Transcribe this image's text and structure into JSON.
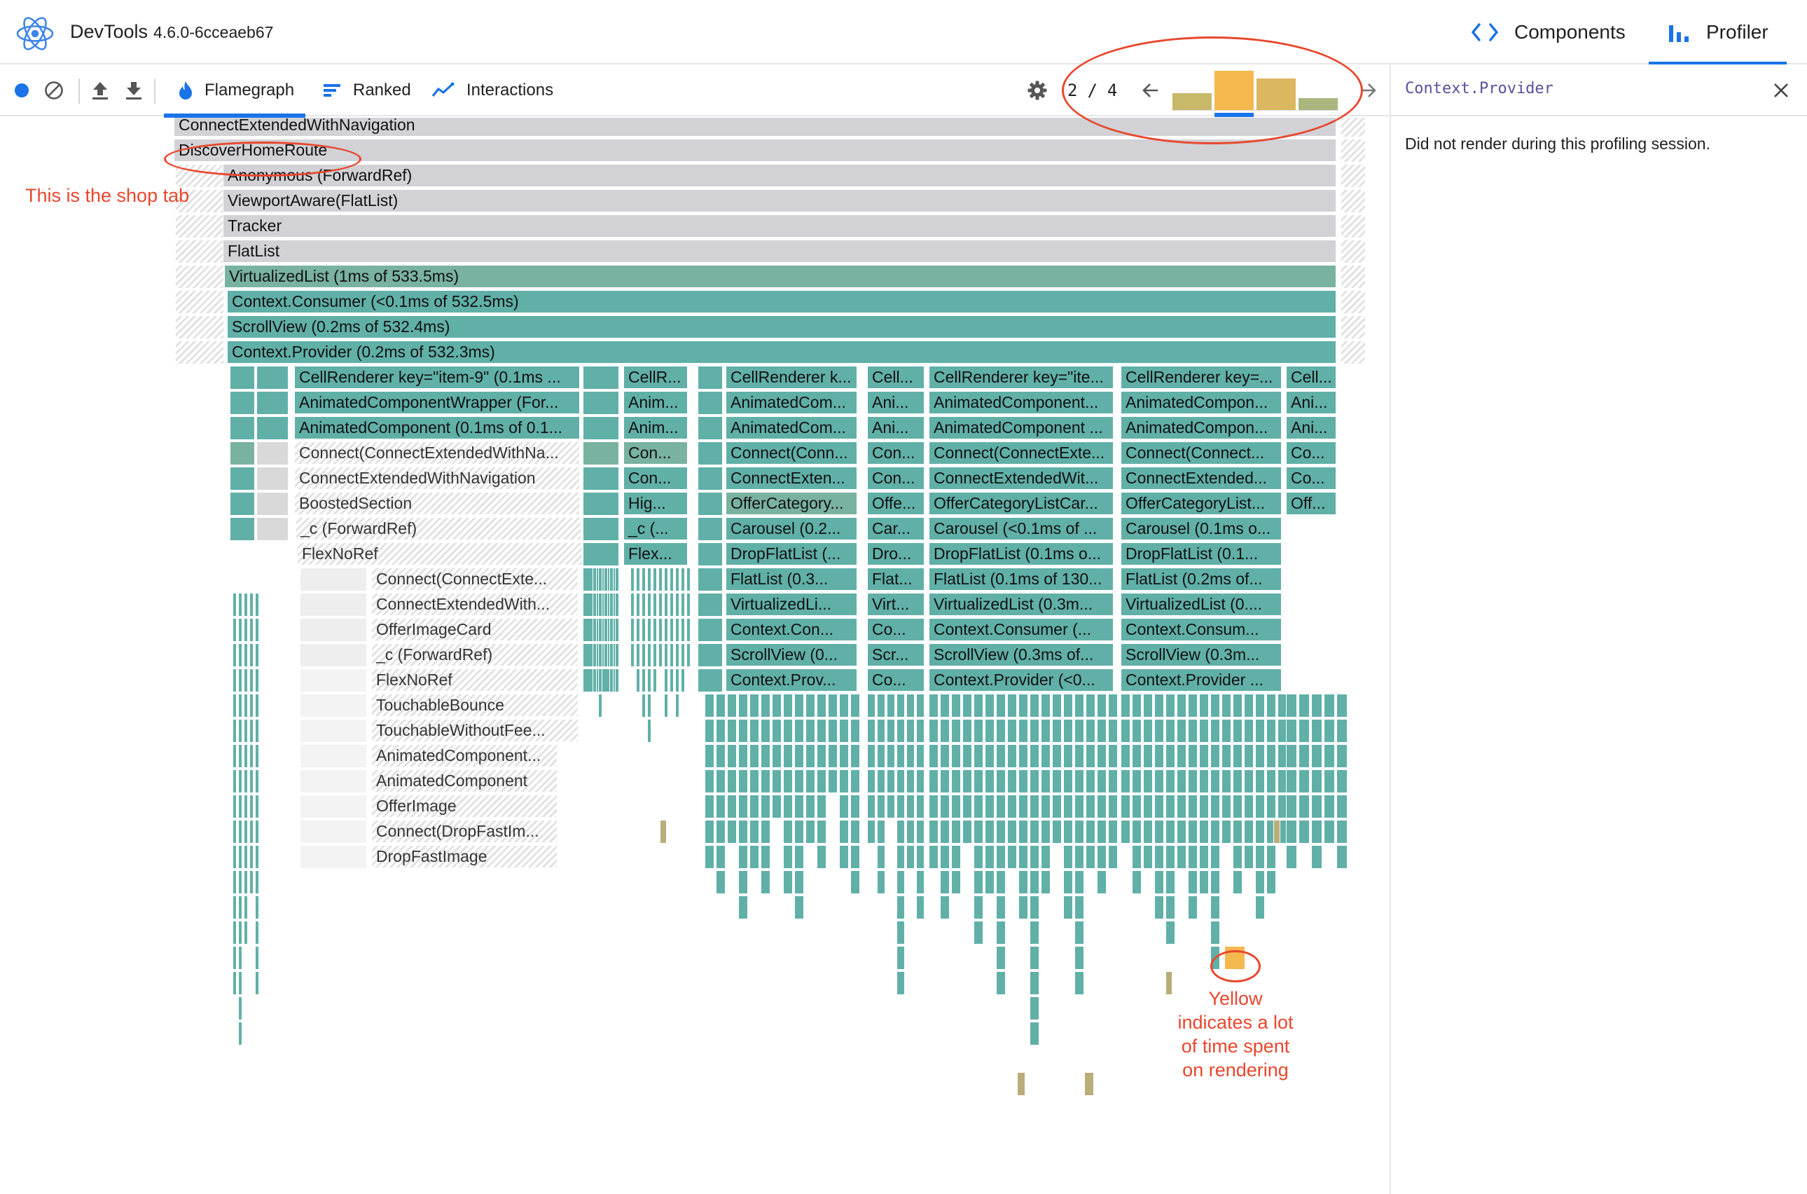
{
  "header": {
    "app_name": "DevTools",
    "version": "4.6.0-6cceaeb67",
    "tabs": [
      {
        "label": "Components",
        "icon": "code-brackets-icon"
      },
      {
        "label": "Profiler",
        "icon": "bar-chart-icon",
        "active": true
      }
    ]
  },
  "toolbar": {
    "buttons": [
      "record-icon",
      "clear-icon",
      "upload-icon",
      "download-icon"
    ],
    "tabs": [
      {
        "label": "Flamegraph",
        "icon": "flame-icon",
        "active": true
      },
      {
        "label": "Ranked",
        "icon": "ranked-list-icon"
      },
      {
        "label": "Interactions",
        "icon": "interactions-icon"
      }
    ],
    "commit_current": "2",
    "commit_separator": "/",
    "commit_total": "4",
    "commit_bars": [
      {
        "height": 0.42,
        "color": "#c7b86a"
      },
      {
        "height": 1.0,
        "color": "#f5b84f",
        "selected": true
      },
      {
        "height": 0.8,
        "color": "#dbb760"
      },
      {
        "height": 0.3,
        "color": "#a9b67e"
      }
    ]
  },
  "side_panel": {
    "title": "Context.Provider",
    "message": "Did not render during this profiling session."
  },
  "flamegraph": {
    "rows": [
      "ConnectExtendedWithNavigation",
      "DiscoverHomeRoute",
      "Anonymous (ForwardRef)",
      "ViewportAware(FlatList)",
      "Tracker",
      "FlatList",
      "VirtualizedList (1ms of 533.5ms)",
      "Context.Consumer (<0.1ms of 532.5ms)",
      "ScrollView (0.2ms of 532.4ms)",
      "Context.Provider (0.2ms of 532.3ms)"
    ],
    "col_a": [
      "CellRenderer key=\"item-9\" (0.1ms ...",
      "AnimatedComponentWrapper (For...",
      "AnimatedComponent (0.1ms of 0.1...",
      "Connect(ConnectExtendedWithNa...",
      "ConnectExtendedWithNavigation",
      "BoostedSection",
      "_c (ForwardRef)",
      "FlexNoRef"
    ],
    "col_a_sub": [
      "Connect(ConnectExte...",
      "ConnectExtendedWith...",
      "OfferImageCard",
      "_c (ForwardRef)",
      "FlexNoRef",
      "TouchableBounce",
      "TouchableWithoutFee...",
      "AnimatedComponent...",
      "AnimatedComponent",
      "OfferImage",
      "Connect(DropFastIm...",
      "DropFastImage"
    ],
    "col_b": [
      "CellR...",
      "Anim...",
      "Anim...",
      "Con...",
      "Con...",
      "Hig...",
      "_c (...",
      "Flex..."
    ],
    "col_c": [
      "CellRenderer k...",
      "AnimatedCom...",
      "AnimatedCom...",
      "Connect(Conn...",
      "ConnectExten...",
      "OfferCategory...",
      "Carousel (0.2...",
      "DropFlatList (...",
      "FlatList (0.3...",
      "VirtualizedLi...",
      "Context.Con...",
      "ScrollView (0...",
      "Context.Prov..."
    ],
    "col_d": [
      "Cell...",
      "Ani...",
      "Ani...",
      "Con...",
      "Con...",
      "Offe...",
      "Car...",
      "Dro...",
      "Flat...",
      "Virt...",
      "Co...",
      "Scr...",
      "Co..."
    ],
    "col_e": [
      "CellRenderer key=\"ite...",
      "AnimatedComponent...",
      "AnimatedComponent ...",
      "Connect(ConnectExte...",
      "ConnectExtendedWit...",
      "OfferCategoryListCar...",
      "Carousel (<0.1ms of ...",
      "DropFlatList (0.1ms o...",
      "FlatList (0.1ms of 130...",
      "VirtualizedList (0.3m...",
      "Context.Consumer (...",
      "ScrollView (0.3ms of...",
      "Context.Provider (<0..."
    ],
    "col_f": [
      "CellRenderer key=...",
      "AnimatedCompon...",
      "AnimatedCompon...",
      "Connect(Connect...",
      "ConnectExtended...",
      "OfferCategoryList...",
      "Carousel (0.1ms o...",
      "DropFlatList (0.1...",
      "FlatList (0.2ms of...",
      "VirtualizedList (0....",
      "Context.Consum...",
      "ScrollView (0.3m...",
      "Context.Provider ..."
    ],
    "col_g": [
      "Cell...",
      "Ani...",
      "Ani...",
      "Co...",
      "Co...",
      "Off..."
    ]
  },
  "annotations": {
    "shop_tab_note": "This is the shop tab",
    "yellow_note": [
      "Yellow",
      "indicates a lot",
      "of time spent",
      "on rendering"
    ]
  },
  "colors": {
    "accent": "#1a73e8",
    "flame_teal": "#60b0a8",
    "flame_gray": "#d1d1d6",
    "annotation_red": "#e8472d",
    "hot_yellow": "#f5b84f"
  }
}
